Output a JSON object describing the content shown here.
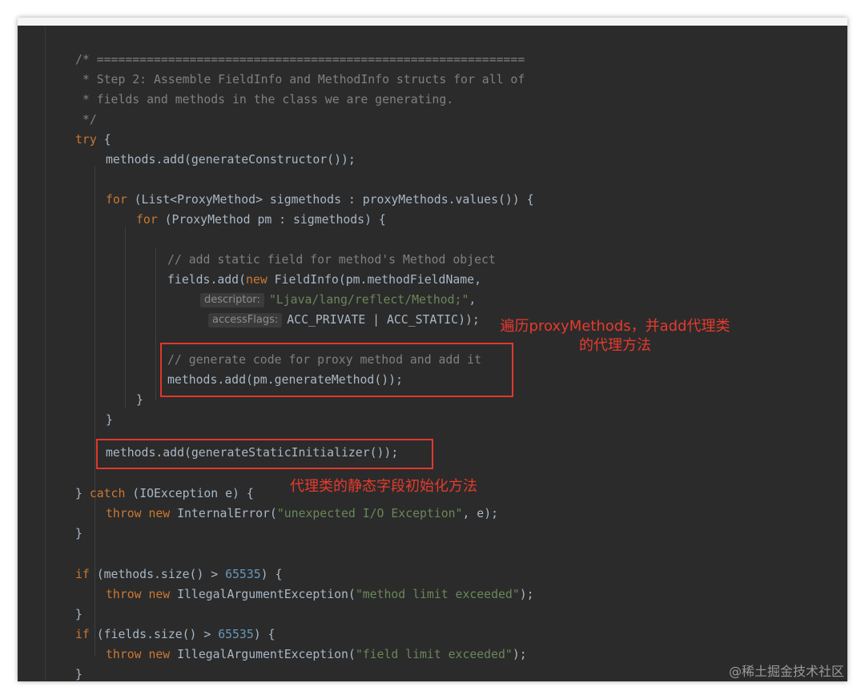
{
  "code": {
    "l1": "/* ============================================================",
    "l2": " * Step 2: Assemble FieldInfo and MethodInfo structs for all of",
    "l3": " * fields and methods in the class we are generating.",
    "l4": " */",
    "l5_kw": "try",
    "l5_rest": " {",
    "l6": "methods.add(generateConstructor());",
    "l8_kw": "for",
    "l8_rest": " (List<ProxyMethod> sigmethods : proxyMethods.values()) {",
    "l9_kw": "for",
    "l9_rest": " (ProxyMethod pm : sigmethods) {",
    "l11": "// add static field for method's Method object",
    "l12_a": "fields.add(",
    "l12_kw": "new",
    "l12_b": " FieldInfo(pm.methodFieldName,",
    "l13_hint": "descriptor:",
    "l13_str": "\"Ljava/lang/reflect/Method;\"",
    "l13_rest": ",",
    "l14_hint": "accessFlags:",
    "l14_rest": "ACC_PRIVATE | ACC_STATIC));",
    "l16": "// generate code for proxy method and add it",
    "l17": "methods.add(pm.generateMethod());",
    "l18": "}",
    "l19": "}",
    "l21": "methods.add(generateStaticInitializer());",
    "l23_a": "} ",
    "l23_kw": "catch",
    "l23_rest": " (IOException e) {",
    "l24_kw1": "throw",
    "l24_kw2": "new",
    "l24_a": " InternalError(",
    "l24_str": "\"unexpected I/O Exception\"",
    "l24_b": ", e);",
    "l25": "}",
    "l27_kw": "if",
    "l27_a": " (methods.size() > ",
    "l27_num": "65535",
    "l27_b": ") {",
    "l28_kw1": "throw",
    "l28_kw2": "new",
    "l28_a": " IllegalArgumentException(",
    "l28_str": "\"method limit exceeded\"",
    "l28_b": ");",
    "l29": "}",
    "l30_kw": "if",
    "l30_a": " (fields.size() > ",
    "l30_num": "65535",
    "l30_b": ") {",
    "l31_kw1": "throw",
    "l31_kw2": "new",
    "l31_a": " IllegalArgumentException(",
    "l31_str": "\"field limit exceeded\"",
    "l31_b": ");",
    "l32": "}"
  },
  "annotations": {
    "proxy_methods_line1": "遍历proxyMethods，并add代理类",
    "proxy_methods_line2": "的代理方法",
    "static_init": "代理类的静态字段初始化方法"
  },
  "watermark": "@稀土掘金技术社区",
  "colors": {
    "background": "#2b2b2b",
    "keyword": "#cc7832",
    "string": "#6a8759",
    "number": "#6897bb",
    "comment": "#808080",
    "text": "#a9b7c6",
    "annotation": "#e83a2d"
  }
}
